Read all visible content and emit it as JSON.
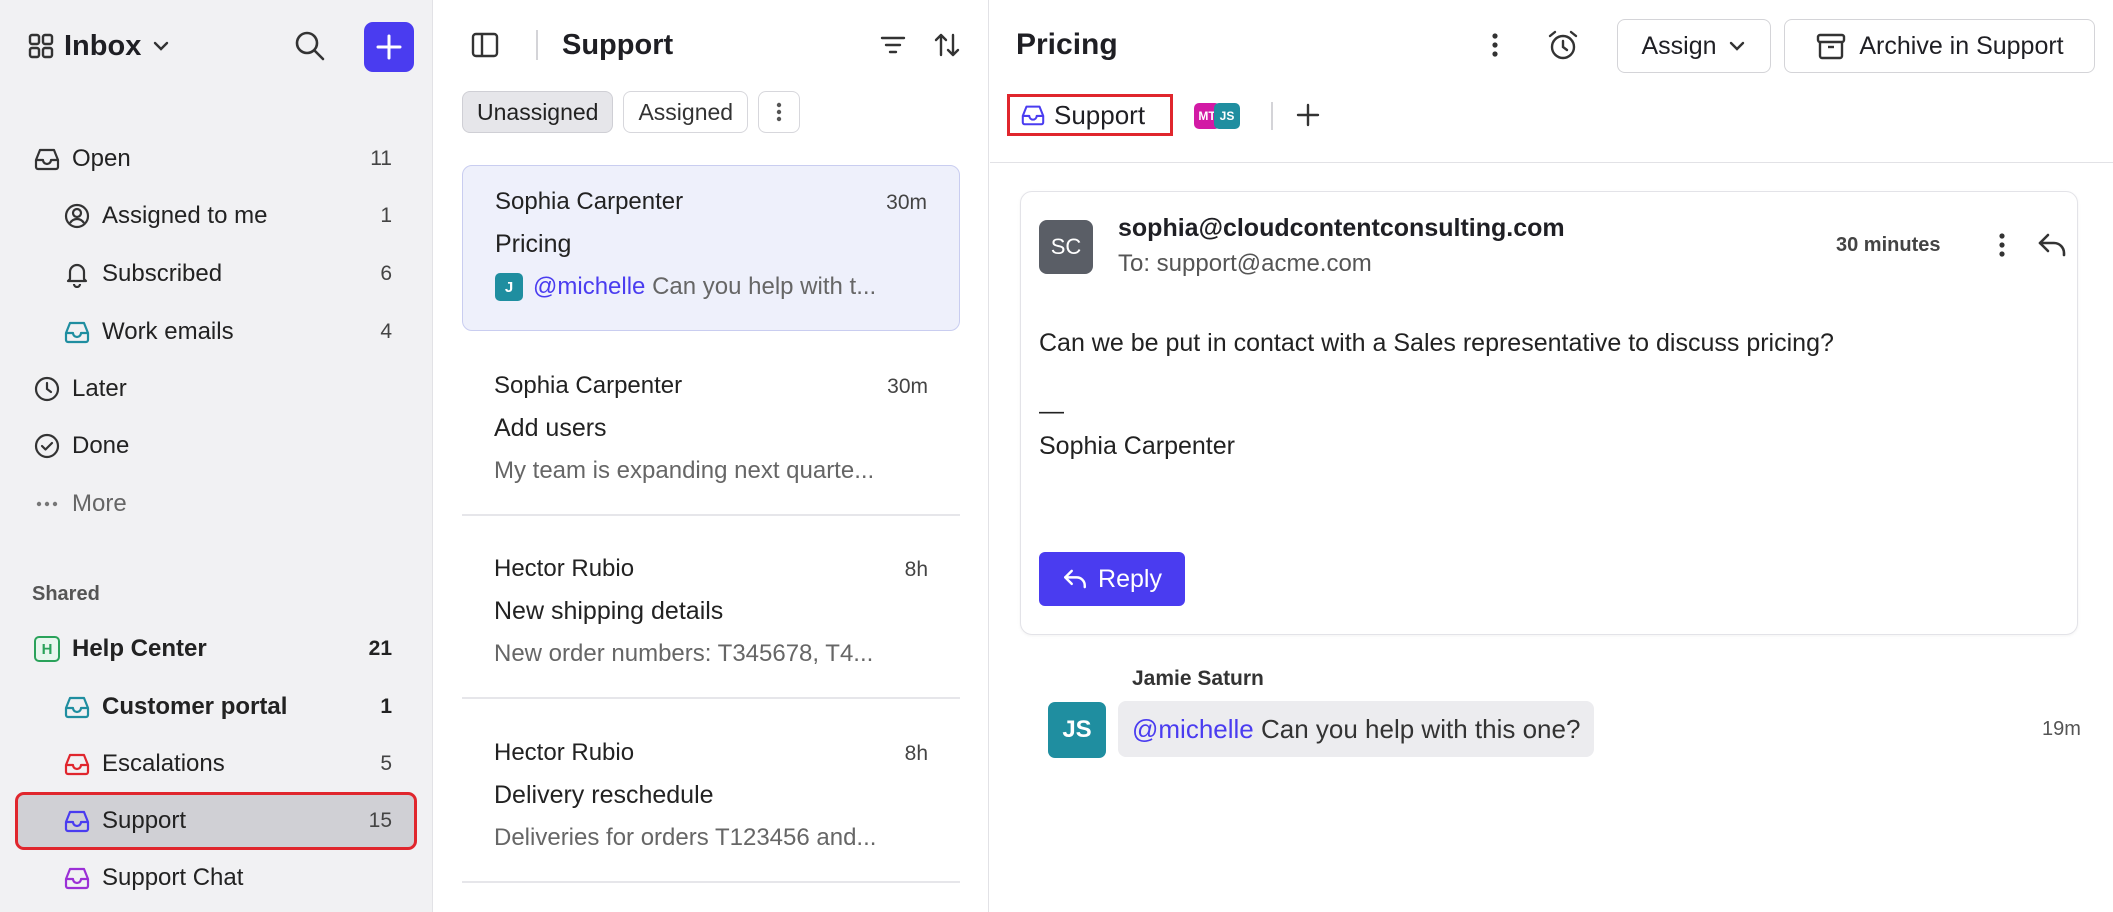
{
  "sidebar": {
    "inbox_label": "Inbox",
    "items": [
      {
        "label": "Open",
        "count": "11"
      },
      {
        "label": "Assigned to me",
        "count": "1"
      },
      {
        "label": "Subscribed",
        "count": "6"
      },
      {
        "label": "Work emails",
        "count": "4"
      },
      {
        "label": "Later",
        "count": ""
      },
      {
        "label": "Done",
        "count": ""
      },
      {
        "label": "More",
        "count": ""
      }
    ],
    "shared_label": "Shared",
    "shared": [
      {
        "label": "Help Center",
        "count": "21",
        "badge": "H"
      },
      {
        "label": "Customer portal",
        "count": "1"
      },
      {
        "label": "Escalations",
        "count": "5"
      },
      {
        "label": "Support",
        "count": "15"
      },
      {
        "label": "Support Chat",
        "count": ""
      }
    ]
  },
  "list": {
    "title": "Support",
    "chips": [
      "Unassigned",
      "Assigned"
    ],
    "conversations": [
      {
        "name": "Sophia Carpenter",
        "time": "30m",
        "subject": "Pricing",
        "avatar": "J",
        "mention": "@michelle",
        "preview": "Can you help with t..."
      },
      {
        "name": "Sophia Carpenter",
        "time": "30m",
        "subject": "Add users",
        "preview": "My team is expanding next quarte..."
      },
      {
        "name": "Hector Rubio",
        "time": "8h",
        "subject": "New shipping details",
        "preview": "New order numbers: T345678, T4..."
      },
      {
        "name": "Hector Rubio",
        "time": "8h",
        "subject": "Delivery reschedule",
        "preview": "Deliveries for orders T123456 and..."
      }
    ]
  },
  "detail": {
    "title": "Pricing",
    "assign_label": "Assign",
    "archive_label": "Archive in Support",
    "tag_label": "Support",
    "avatars": [
      "MT",
      "JS"
    ],
    "message": {
      "avatar": "SC",
      "from": "sophia@cloudcontentconsulting.com",
      "to": "To: support@acme.com",
      "time": "30 minutes",
      "body_line": "Can we be put in contact with a Sales representative to discuss pricing?",
      "dash": "—",
      "signature": "Sophia Carpenter",
      "reply_label": "Reply"
    },
    "note": {
      "author": "Jamie Saturn",
      "avatar": "JS",
      "mention": "@michelle",
      "text": " Can you help with this one?",
      "time": "19m"
    }
  },
  "colors": {
    "accent": "#4a3cf0",
    "highlight": "#e0262d",
    "teal": "#1f8ea0"
  }
}
